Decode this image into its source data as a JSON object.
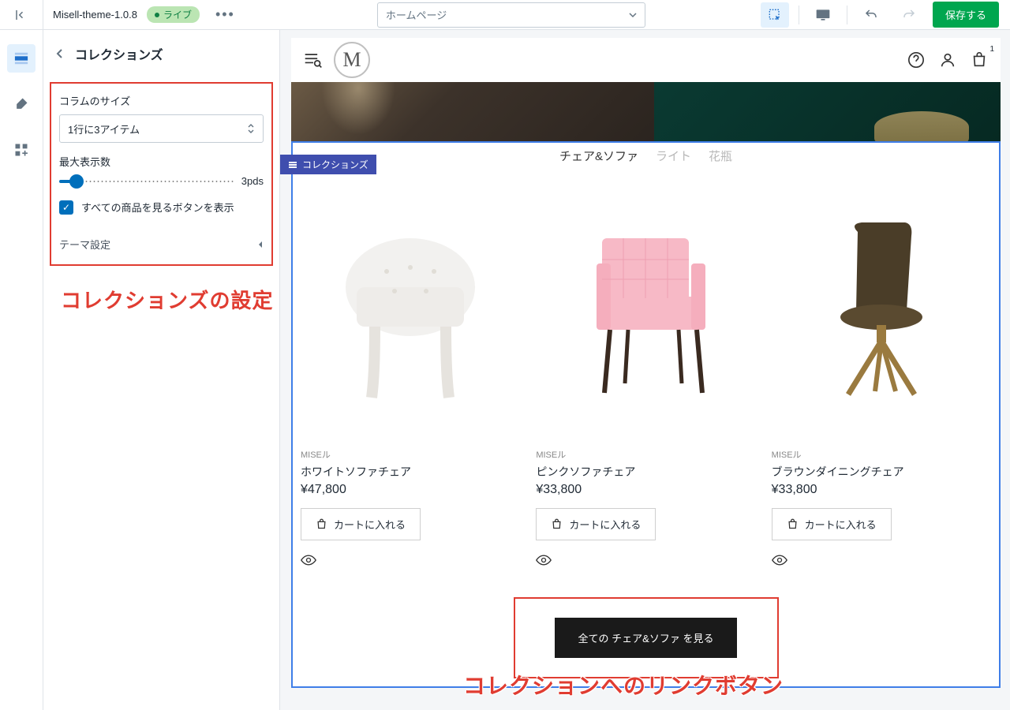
{
  "topbar": {
    "theme_name": "Misell-theme-1.0.8",
    "live_badge": "ライブ",
    "page_select": "ホームページ",
    "save": "保存する"
  },
  "sidebar": {
    "title": "コレクションズ",
    "col_size_label": "コラムのサイズ",
    "col_size_value": "1行に3アイテム",
    "max_label": "最大表示数",
    "max_value": "3pds",
    "checkbox_label": "すべての商品を見るボタンを表示",
    "theme_settings": "テーマ設定"
  },
  "annotations": {
    "settings": "コレクションズの設定",
    "link_button": "コレクションへのリンクボタン"
  },
  "preview": {
    "logo_letter": "M",
    "cart_count": "1",
    "section_label": "コレクションズ",
    "tabs": [
      "チェア&ソファ",
      "ライト",
      "花瓶"
    ],
    "brand": "MISEル",
    "products": [
      {
        "name": "ホワイトソファチェア",
        "price": "¥47,800"
      },
      {
        "name": "ピンクソファチェア",
        "price": "¥33,800"
      },
      {
        "name": "ブラウンダイニングチェア",
        "price": "¥33,800"
      }
    ],
    "add_to_cart": "カートに入れる",
    "view_all": "全ての チェア&ソファ を見る"
  }
}
